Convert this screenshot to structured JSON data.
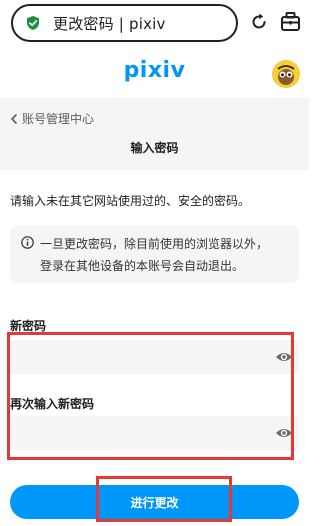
{
  "browser": {
    "url_text": "更改密码 | pixiv",
    "icons": {
      "secure": "shield-check-icon",
      "refresh": "refresh-icon",
      "tabs": "tabs-icon"
    }
  },
  "header": {
    "logo": "pixiv",
    "avatar_icon": "user-avatar"
  },
  "breadcrumb": {
    "label": "账号管理中心",
    "icon": "chevron-left-icon"
  },
  "page": {
    "title": "输入密码",
    "instruction": "请输入未在其它网站使用过的、安全的密码。",
    "notice_line1": "一旦更改密码，除目前使用的浏览器以外，",
    "notice_line2": "登录在其他设备的本账号会自动退出。",
    "notice_icon": "info-icon"
  },
  "form": {
    "new_password_label": "新密码",
    "confirm_password_label": "再次输入新密码",
    "new_password_value": "",
    "confirm_password_value": "",
    "toggle_icon": "eye-icon",
    "submit_label": "进行更改"
  },
  "colors": {
    "brand": "#0096fa",
    "highlight": "#e53935",
    "panel": "#f5f5f5"
  }
}
